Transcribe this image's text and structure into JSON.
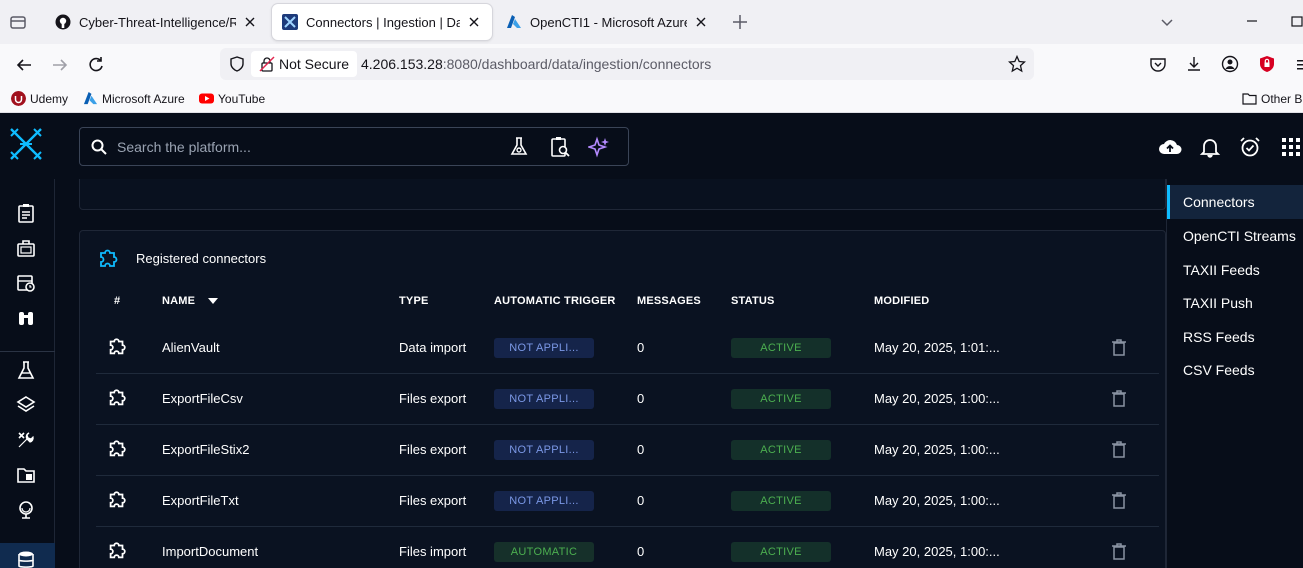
{
  "browser": {
    "tabs": [
      {
        "title": "Cyber-Threat-Intelligence/READ",
        "active": false
      },
      {
        "title": "Connectors | Ingestion | Data | O",
        "active": true
      },
      {
        "title": "OpenCTI1 - Microsoft Azure",
        "active": false
      }
    ],
    "security_label": "Not Secure",
    "url_host": "4.206.153.28",
    "url_rest": ":8080/dashboard/data/ingestion/connectors",
    "bookmarks": [
      "Udemy",
      "Microsoft Azure",
      "YouTube"
    ],
    "other_bookmarks": "Other B"
  },
  "app": {
    "search_placeholder": "Search the platform...",
    "card_title": "Registered connectors",
    "columns": {
      "index": "#",
      "name": "NAME",
      "type": "TYPE",
      "trigger": "AUTOMATIC TRIGGER",
      "messages": "MESSAGES",
      "status": "STATUS",
      "modified": "MODIFIED"
    },
    "rows": [
      {
        "name": "AlienVault",
        "type": "Data import",
        "trigger": "NOT APPLI...",
        "messages": "0",
        "status": "ACTIVE",
        "modified": "May 20, 2025, 1:01:..."
      },
      {
        "name": "ExportFileCsv",
        "type": "Files export",
        "trigger": "NOT APPLI...",
        "messages": "0",
        "status": "ACTIVE",
        "modified": "May 20, 2025, 1:00:..."
      },
      {
        "name": "ExportFileStix2",
        "type": "Files export",
        "trigger": "NOT APPLI...",
        "messages": "0",
        "status": "ACTIVE",
        "modified": "May 20, 2025, 1:00:..."
      },
      {
        "name": "ExportFileTxt",
        "type": "Files export",
        "trigger": "NOT APPLI...",
        "messages": "0",
        "status": "ACTIVE",
        "modified": "May 20, 2025, 1:00:..."
      },
      {
        "name": "ImportDocument",
        "type": "Files import",
        "trigger": "AUTOMATIC",
        "messages": "0",
        "status": "ACTIVE",
        "modified": "May 20, 2025, 1:00:..."
      }
    ],
    "right_nav": [
      "Connectors",
      "OpenCTI Streams",
      "TAXII Feeds",
      "TAXII Push",
      "RSS Feeds",
      "CSV Feeds"
    ],
    "right_nav_selected": "Connectors",
    "colors": {
      "accent": "#0fbcff",
      "active_green": "#4caf50",
      "na_blue": "#7b98e6",
      "background": "#070d19"
    }
  }
}
